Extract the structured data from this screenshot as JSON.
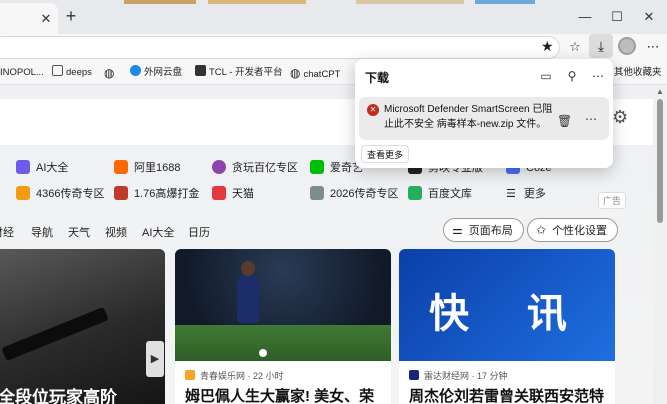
{
  "window": {
    "tab_close": "✕",
    "new_tab": "+",
    "minimize": "—",
    "maximize": "☐",
    "close": "✕"
  },
  "toolbar": {
    "star_icon": "star-icon",
    "favorites_icon": "favorites-icon",
    "download_icon": "download-icon",
    "more": "⋯"
  },
  "bookmarks": [
    {
      "label": "INOPOL...",
      "color": "#3a7bd5"
    },
    {
      "label": "deeps",
      "color": "#555555"
    },
    {
      "label": "",
      "color": "#555555"
    },
    {
      "label": "外网云盘",
      "color": "#1e88e5"
    },
    {
      "label": "TCL - 开发者平台",
      "color": "#333333"
    },
    {
      "label": "chatCPT",
      "color": "#555555"
    }
  ],
  "bookmarks_other": "其他收藏夹",
  "downloads": {
    "title": "下载",
    "item_message": "Microsoft Defender SmartScreen 已阻止此不安全 病毒样本-new.zip 文件。",
    "see_more": "查看更多"
  },
  "quick_links": {
    "row1": [
      {
        "label": "AI大全",
        "color": "#6c5ce7"
      },
      {
        "label": "阿里1688",
        "color": "#ff6a00"
      },
      {
        "label": "贪玩百亿专区",
        "color": "#8e44ad"
      },
      {
        "label": "爱奇艺",
        "color": "#00be06"
      },
      {
        "label": "剪映专业版",
        "color": "#222222"
      },
      {
        "label": "Coze",
        "color": "#4a6cf7"
      }
    ],
    "row2": [
      {
        "label": "4366传奇专区",
        "color": "#f39c12"
      },
      {
        "label": "1.76高爆打金",
        "color": "#c0392b"
      },
      {
        "label": "天猫",
        "color": "#e4393c"
      },
      {
        "label": "2026传奇专区",
        "color": "#7f8c8d"
      },
      {
        "label": "百度文库",
        "color": "#27ae60"
      },
      {
        "label": "更多",
        "color": "#555555"
      }
    ],
    "ad": "广告"
  },
  "nav": {
    "items": [
      "财经",
      "导航",
      "天气",
      "视频",
      "AI大全",
      "日历"
    ],
    "layout_button": "页面布局",
    "personalize_button": "个性化设置"
  },
  "cards": [
    {
      "title": "全段位玩家高阶",
      "source": "",
      "time": ""
    },
    {
      "title": "姆巴佩人生大赢家! 美女、荣",
      "source": "青春娱乐网",
      "time": "22 小时",
      "source_color": "#f5a623"
    },
    {
      "title": "周杰伦刘若雷曾关联西安范特",
      "source": "雷达财经网",
      "time": "17 分钟",
      "source_color": "#1a237e",
      "image_text": "快 讯"
    }
  ]
}
